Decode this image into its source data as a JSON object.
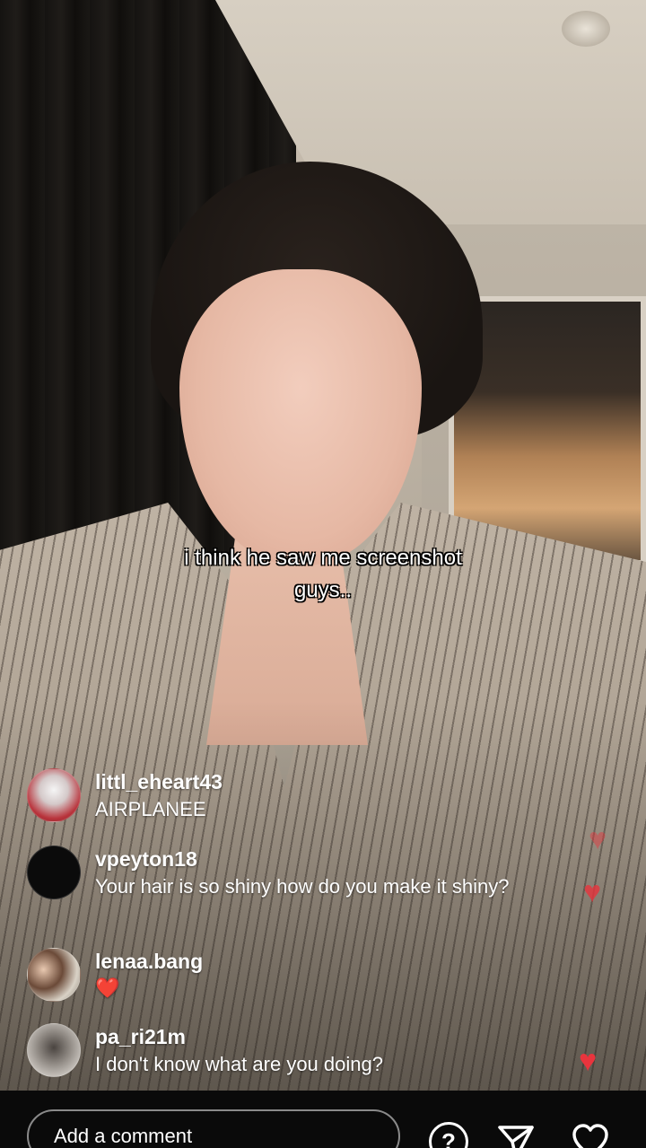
{
  "video": {
    "caption_line1": "i think he saw me screenshot",
    "caption_line2": "guys.."
  },
  "comments": [
    {
      "username": "littl_eheart43",
      "message": "AIRPLANEE",
      "avatar": "avatar-red-white"
    },
    {
      "username": "vpeyton18",
      "message": "Your hair is so shiny how do you make it shiny?",
      "avatar": "avatar-black"
    },
    {
      "username": "lenaa.bang",
      "message": "❤️",
      "avatar": "avatar-photo"
    },
    {
      "username": "pa_ri21m",
      "message": "I don't know what are you doing?",
      "avatar": "avatar-photo-grey"
    }
  ],
  "bottom_bar": {
    "comment_placeholder": "Add a comment",
    "icons": [
      "help-icon",
      "send-icon",
      "heart-icon"
    ]
  },
  "colors": {
    "heart": "#e8343d",
    "background": "#0a0a0a"
  }
}
